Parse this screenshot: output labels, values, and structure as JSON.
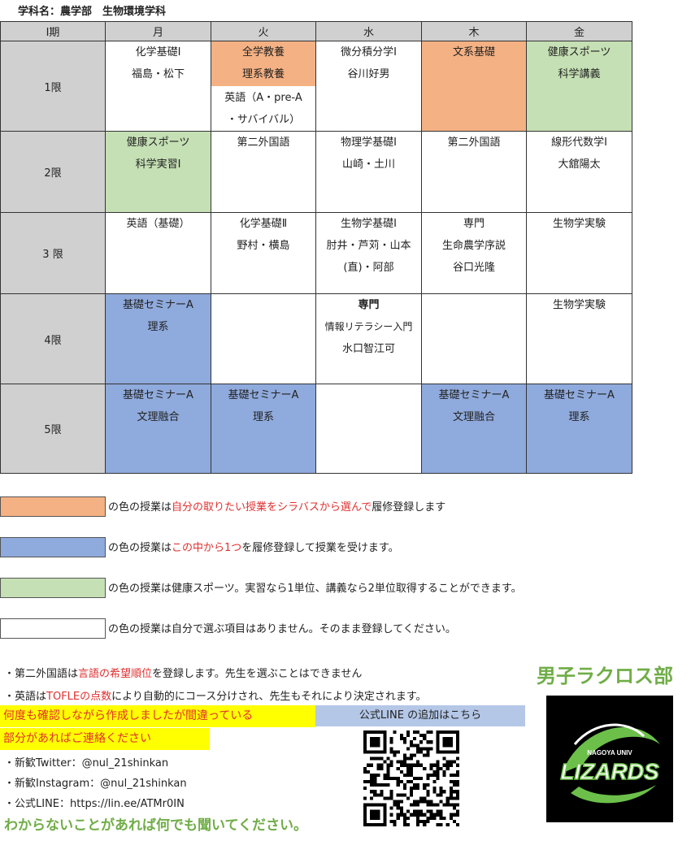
{
  "title": "学科名：農学部　生物環境学科",
  "header": {
    "corner": "Ⅰ期",
    "days": [
      "月",
      "火",
      "水",
      "木",
      "金"
    ]
  },
  "periods": [
    "1限",
    "2限",
    "3 限",
    "4限",
    "5限"
  ],
  "cells": {
    "p1": {
      "mon": [
        "化学基礎Ⅰ",
        "福島・松下"
      ],
      "tue_top": [
        "全学教養",
        "理系教養"
      ],
      "tue_bottom": [
        "英語（A・pre-A",
        "・サバイバル）"
      ],
      "wed": [
        "微分積分学Ⅰ",
        "谷川好男"
      ],
      "thu": [
        "文系基礎"
      ],
      "fri": [
        "健康スポーツ",
        "科学講義"
      ]
    },
    "p2": {
      "mon": [
        "健康スポーツ",
        "科学実習Ⅰ"
      ],
      "tue": [
        "第二外国語"
      ],
      "wed": [
        "物理学基礎Ⅰ",
        "山崎・土川"
      ],
      "thu": [
        "第二外国語"
      ],
      "fri": [
        "線形代数学Ⅰ",
        "大舘陽太"
      ]
    },
    "p3": {
      "mon": [
        "英語（基礎）"
      ],
      "tue": [
        "化学基礎Ⅱ",
        "野村・横島"
      ],
      "wed": [
        "生物学基礎Ⅰ",
        "肘井・芦苅・山本",
        "(直)・阿部"
      ],
      "thu": [
        "専門",
        "生命農学序説",
        "谷口光隆"
      ],
      "fri": [
        "生物学実験"
      ]
    },
    "p4": {
      "mon": [
        "基礎セミナーA",
        "理系"
      ],
      "wed": [
        "専門",
        "情報リテラシー入門",
        "水口智江可"
      ],
      "fri": [
        "生物学実験"
      ]
    },
    "p5": {
      "mon": [
        "基礎セミナーA",
        "文理融合"
      ],
      "tue": [
        "基礎セミナーA",
        "理系"
      ],
      "thu": [
        "基礎セミナーA",
        "文理融合"
      ],
      "fri": [
        "基礎セミナーA",
        "理系"
      ]
    }
  },
  "legend": [
    {
      "color": "#f4b183",
      "pre": "の色の授業は",
      "red": "自分の取りたい授業をシラバスから選んで",
      "post": "履修登録します"
    },
    {
      "color": "#8faadc",
      "pre": "の色の授業は",
      "red": "この中から1つ",
      "post": "を履修登録して授業を受けます。"
    },
    {
      "color": "#c5e0b4",
      "pre": "の色の授業は健康スポーツ。実習なら1単位、講義なら2単位取得することができます。",
      "red": "",
      "post": ""
    },
    {
      "color": "#ffffff",
      "pre": "の色の授業は自分で選ぶ項目はありません。そのまま登録してください。",
      "red": "",
      "post": ""
    }
  ],
  "notes": {
    "n1_pre": "・第二外国語は",
    "n1_red": "言語の希望順位",
    "n1_post": "を登録します。先生を選ぶことはできません",
    "n2_pre": "・英語は",
    "n2_red": "TOFLEの点数",
    "n2_post": "により自動的にコース分けされ、先生もそれにより決定されます。",
    "warn1": "何度も確認しながら作成しましたが間違っている",
    "warn2": "部分があればご連絡ください",
    "twitter": "・新歓Twitter：@nul_21shinkan",
    "instagram": "・新歓Instagram：@nul_21shinkan",
    "line": "・公式LINE：https://lin.ee/ATMr0IN",
    "ask": "わからないことがあれば何でも聞いてください。"
  },
  "line_bar": "公式LINE の追加はこちら",
  "club": "男子ラクロス部",
  "logo": {
    "top": "NAGOYA UNIV",
    "main": "LIZARDS"
  }
}
